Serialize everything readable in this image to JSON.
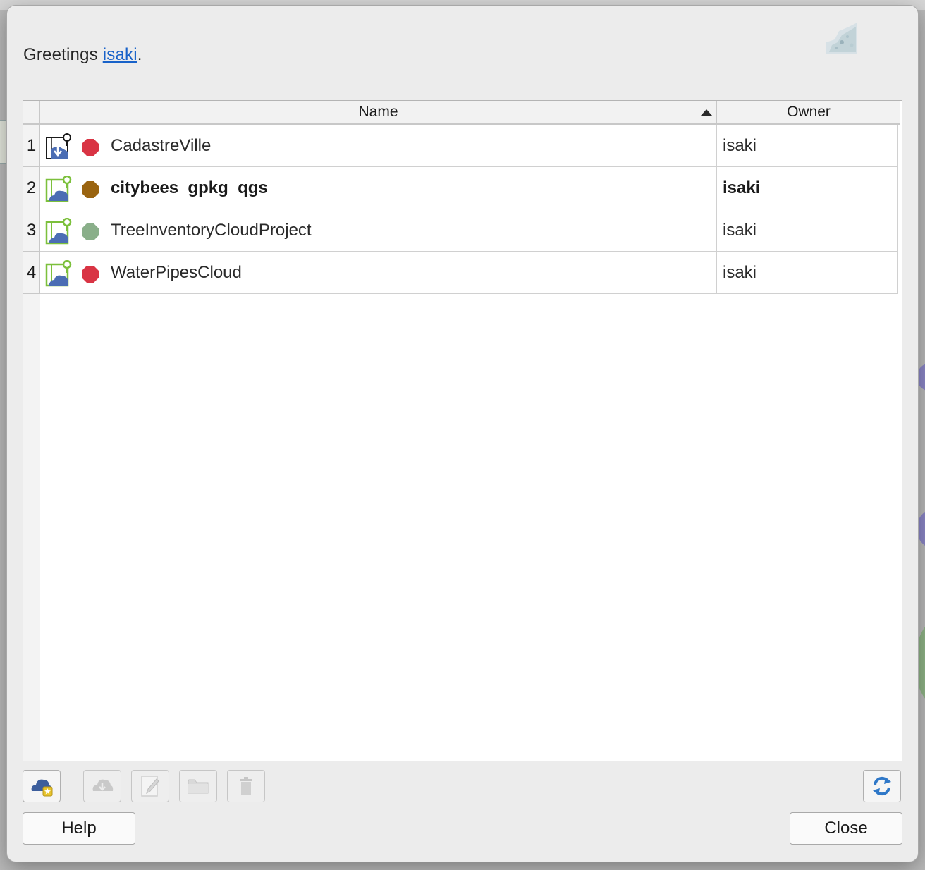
{
  "greeting": {
    "prefix": "Greetings ",
    "username": "isaki",
    "suffix": "."
  },
  "table": {
    "columns": [
      "Name",
      "Owner"
    ],
    "sort": {
      "column": "Name",
      "direction": "ascending"
    },
    "rows": [
      {
        "num": "1",
        "name": "CadastreVille",
        "owner": "isaki",
        "icon": "local-project-icon",
        "status_color": "#d93444",
        "bold": false
      },
      {
        "num": "2",
        "name": "citybees_gpkg_qgs",
        "owner": "isaki",
        "icon": "cloud-project-icon",
        "status_color": "#9a6410",
        "bold": true
      },
      {
        "num": "3",
        "name": "TreeInventoryCloudProject",
        "owner": "isaki",
        "icon": "cloud-project-icon",
        "status_color": "#8aaf8a",
        "bold": false
      },
      {
        "num": "4",
        "name": "WaterPipesCloud",
        "owner": "isaki",
        "icon": "cloud-project-icon",
        "status_color": "#d93444",
        "bold": false
      }
    ]
  },
  "toolbar": {
    "icons": [
      "create-cloud-project-icon",
      "download-project-icon",
      "edit-project-icon",
      "open-folder-icon",
      "delete-icon",
      "refresh-icon"
    ]
  },
  "buttons": {
    "help": "Help",
    "close": "Close"
  }
}
